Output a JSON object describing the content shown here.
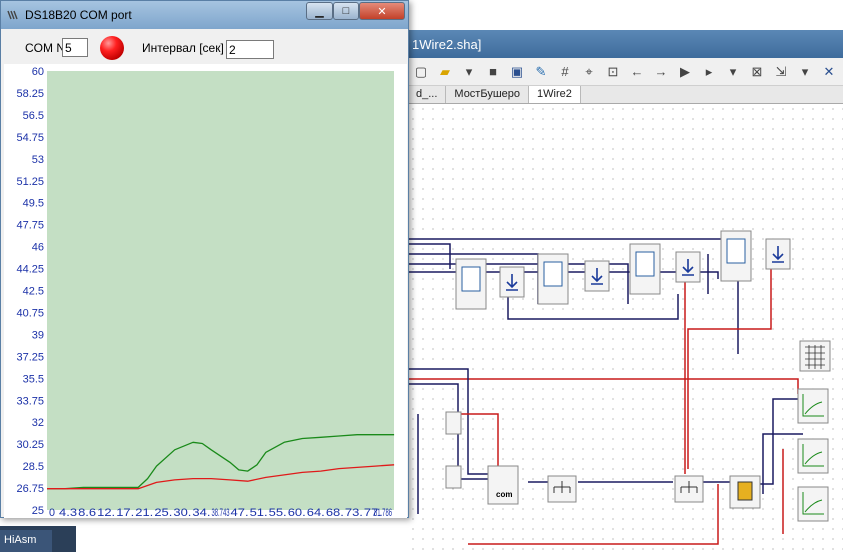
{
  "editor": {
    "title": "1Wire2.sha]",
    "tabs": [
      {
        "label": "d_..."
      },
      {
        "label": "МостБушеро"
      },
      {
        "label": "1Wire2"
      }
    ],
    "taskbar_label": "HiAsm"
  },
  "dialog": {
    "title": "DS18B20 COM port",
    "com_label": "COM N",
    "com_value": "5",
    "interval_label": "Интервал [сек]",
    "interval_value": "2"
  },
  "colors": {
    "plot_bg": "#c4dfc4",
    "tick_text": "#1c32a8",
    "series_green": "#1a8a1a",
    "series_red": "#e01a1a",
    "led": "#ff2020"
  },
  "chart_data": {
    "type": "line",
    "ylim": [
      25,
      60
    ],
    "xlim": [
      0,
      81.786
    ],
    "yticks": [
      "60",
      "58.25",
      "56.5",
      "54.75",
      "53",
      "51.25",
      "49.5",
      "47.75",
      "46",
      "44.25",
      "42.5",
      "40.75",
      "39",
      "37.25",
      "35.5",
      "33.75",
      "32",
      "30.25",
      "28.5",
      "26.75",
      "25"
    ],
    "xticks": [
      "0",
      "4.3",
      "8.6",
      "12.",
      "17.",
      "21.",
      "25.",
      "30.",
      "34.",
      "38.743",
      "47.",
      "51.",
      "55.",
      "60.",
      "64.",
      "68.",
      "73.",
      "77.",
      "81.786"
    ],
    "grid": false,
    "legend": "none",
    "series": [
      {
        "x": [
          0,
          4.3,
          8.6,
          12.9,
          17.2,
          21.5,
          23.7,
          25.8,
          30.1,
          34.4,
          36.6,
          38.7,
          43.1,
          45.2,
          47.3,
          49.5,
          51.6,
          55.9,
          60.2,
          64.5,
          68.8,
          73.1,
          77.4,
          81.8
        ],
        "y": [
          26.7,
          26.7,
          26.8,
          26.8,
          26.8,
          26.8,
          27.5,
          28.5,
          29.8,
          30.4,
          30.3,
          29.8,
          28.8,
          28.2,
          28.1,
          28.6,
          29.6,
          30.4,
          30.7,
          30.8,
          30.9,
          31.0,
          31.0,
          31.0
        ]
      },
      {
        "x": [
          0,
          4.3,
          8.6,
          12.9,
          17.2,
          21.5,
          25.8,
          30.1,
          34.4,
          38.7,
          43.1,
          47.3,
          51.6,
          55.9,
          60.2,
          64.5,
          68.8,
          73.1,
          77.4,
          81.8
        ],
        "y": [
          26.7,
          26.7,
          26.7,
          26.7,
          26.7,
          26.7,
          27.2,
          27.4,
          27.5,
          27.5,
          27.4,
          27.3,
          27.6,
          27.8,
          28.0,
          28.1,
          28.3,
          28.4,
          28.5,
          28.6
        ]
      }
    ]
  }
}
